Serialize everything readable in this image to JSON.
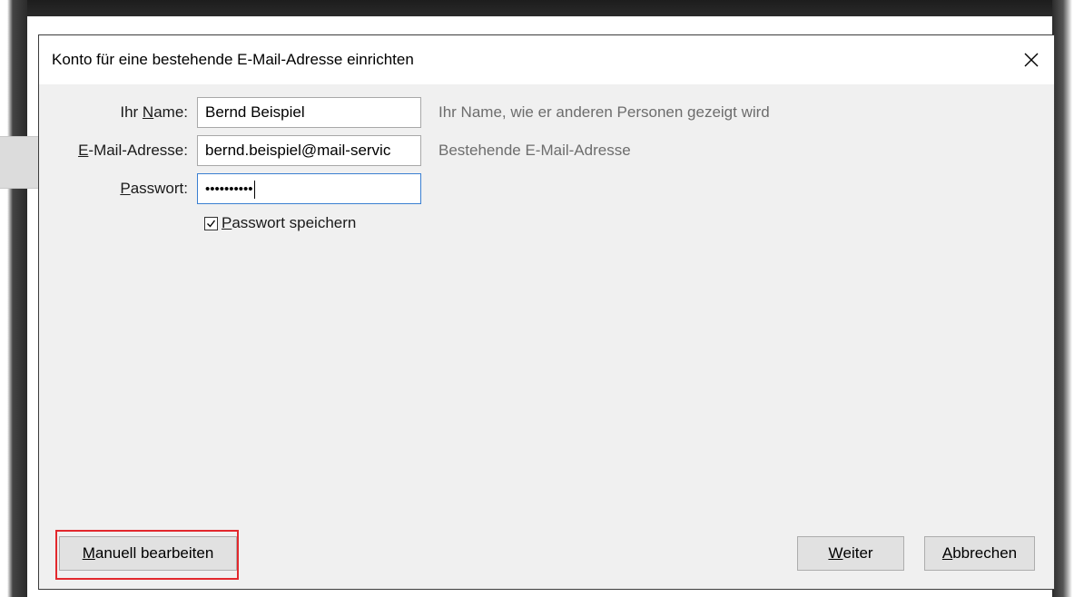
{
  "dialog": {
    "title": "Konto für eine bestehende E-Mail-Adresse einrichten"
  },
  "form": {
    "name": {
      "label_pre": "Ihr ",
      "label_ul": "N",
      "label_post": "ame:",
      "value": "Bernd Beispiel",
      "hint": "Ihr Name, wie er anderen Personen gezeigt wird"
    },
    "email": {
      "label_pre": "",
      "label_ul": "E",
      "label_post": "-Mail-Adresse:",
      "value": "bernd.beispiel@mail-servic",
      "hint": "Bestehende E-Mail-Adresse"
    },
    "password": {
      "label_pre": "",
      "label_ul": "P",
      "label_post": "asswort:",
      "value": "••••••••••"
    },
    "remember": {
      "checked": true,
      "label_ul": "P",
      "label_post": "asswort speichern"
    }
  },
  "buttons": {
    "manual": {
      "label_ul": "M",
      "label_post": "anuell bearbeiten"
    },
    "next": {
      "label_ul": "W",
      "label_post": "eiter"
    },
    "cancel": {
      "label_ul": "A",
      "label_post": "bbrechen"
    }
  },
  "icons": {
    "close": "close-icon",
    "check": "checkmark-icon"
  },
  "colors": {
    "highlight": "#e2282d",
    "focus_border": "#3a7fd1",
    "hint_text": "#6d6d6d"
  }
}
